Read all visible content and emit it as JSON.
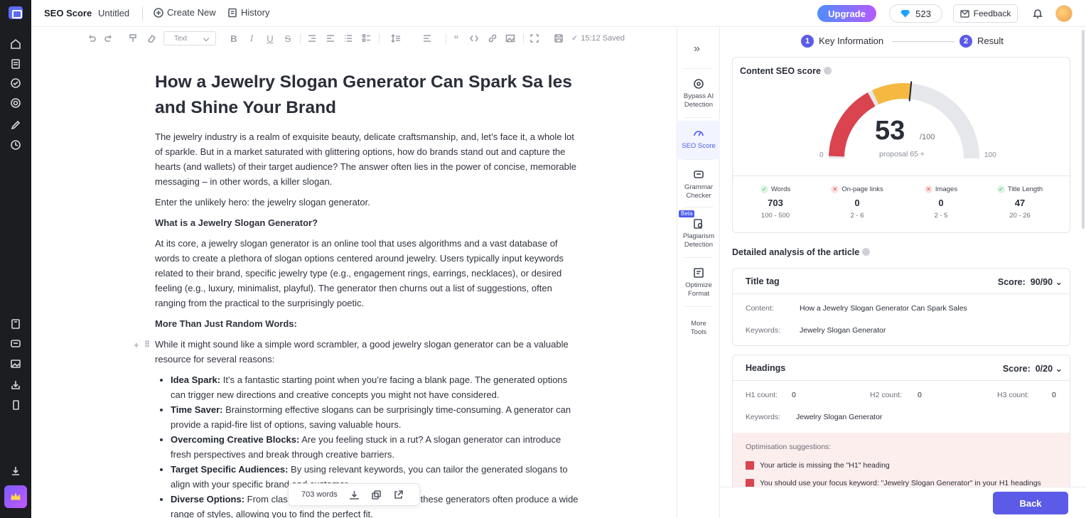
{
  "topbar": {
    "title": "SEO Score",
    "doc_name": "Untitled",
    "create_new": "Create New",
    "history": "History",
    "upgrade": "Upgrade",
    "credits": "523",
    "feedback": "Feedback"
  },
  "toolbar": {
    "text_style": "Text",
    "saved": "15:12 Saved"
  },
  "article": {
    "title": "How a Jewelry Slogan Generator Can Spark Sa les and Shine Your Brand",
    "p1": "The jewelry industry is a realm of exquisite beauty, delicate craftsmanship, and, let’s face it, a whole lot of sparkle. But in a market saturated with glittering options, how do brands stand out and capture the hearts (and wallets) of their target audience? The answer often lies in the power of concise, memorable messaging – in other words, a killer slogan.",
    "p2": "Enter the unlikely hero: the jewelry slogan generator.",
    "h2": "What is a Jewelry Slogan Generator?",
    "p3": "At its core, a jewelry slogan generator is an online tool that uses algorithms and a vast database of words to create a plethora of slogan options centered around jewelry. Users typically input keywords related to their brand, specific jewelry type (e.g., engagement rings, earrings, necklaces), or desired feeling (e.g., luxury, minimalist, playful). The generator then churns out a list of suggestions, often ranging from the practical to the surprisingly poetic.",
    "h3": "More Than Just Random Words:",
    "p4": "While it might sound like a simple word scrambler, a good jewelry slogan generator can be a valuable resource for several reasons:",
    "list": [
      {
        "bold": "Idea Spark:",
        "text": " It’s a fantastic starting point when you’re facing a blank page. The generated options can trigger new directions and creative concepts you might not have considered."
      },
      {
        "bold": "Time Saver:",
        "text": " Brainstorming effective slogans can be surprisingly time-consuming. A generator can provide a rapid-fire list of options, saving valuable hours."
      },
      {
        "bold": "Overcoming Creative Blocks:",
        "text": " Are you feeling stuck in a rut? A slogan generator can introduce fresh perspectives and break through creative barriers."
      },
      {
        "bold": "Target Specific Audiences:",
        "text": " By using relevant keywords, you can tailor the generated slogans to align with your specific brand and customer."
      },
      {
        "bold": "Diverse Options:",
        "text": " From classic and elegant to fun and edgy, these generators often produce a wide range of styles, allowing you to find the perfect fit."
      }
    ],
    "word_count": "703 words"
  },
  "tools": {
    "bypass": "Bypass AI Detection",
    "seo": "SEO Score",
    "grammar": "Grammar Checker",
    "beta": "Beta",
    "plagiarism": "Plagiarism Detection",
    "optimize": "Optimize Format",
    "more": "More Tools"
  },
  "steps": {
    "s1_num": "1",
    "s1": "Key Information",
    "s2_num": "2",
    "s2": "Result"
  },
  "seo": {
    "title": "Content SEO score",
    "score": "53",
    "max": "/100",
    "proposal": "proposal 65 +",
    "min_label": "0",
    "max_label": "100",
    "score_value": 53,
    "metrics": [
      {
        "label": "Words",
        "status": "ok",
        "value": "703",
        "range": "100 - 500"
      },
      {
        "label": "On-page links",
        "status": "bad",
        "value": "0",
        "range": "2 - 6"
      },
      {
        "label": "Images",
        "status": "bad",
        "value": "0",
        "range": "2 - 5"
      },
      {
        "label": "Title Length",
        "status": "ok",
        "value": "47",
        "range": "20 - 26"
      }
    ]
  },
  "detail": {
    "title": "Detailed analysis of the article",
    "title_tag": {
      "label": "Title tag",
      "score_label": "Score:",
      "score": "90/90",
      "content_key": "Content:",
      "content_val": "How a Jewelry Slogan Generator Can Spark Sales",
      "keywords_key": "Keywords:",
      "keywords_val": "Jewelry Slogan Generator"
    },
    "headings": {
      "label": "Headings",
      "score_label": "Score:",
      "score": "0/20",
      "h1_key": "H1 count:",
      "h1_val": "0",
      "h2_key": "H2 count:",
      "h2_val": "0",
      "h3_key": "H3 count:",
      "h3_val": "0",
      "keywords_key": "Keywords:",
      "keywords_val": "Jewelry Slogan Generator",
      "suggest_title": "Optimisation suggestions:",
      "suggestions": [
        "Your article is missing the \"H1\" heading",
        "You should use your focus keyword: \"Jewelry Slogan Generator\" in your H1 headings"
      ]
    }
  },
  "footer": {
    "back": "Back"
  },
  "colors": {
    "accent": "#5b5be8",
    "gauge_red": "#d9444e",
    "gauge_yellow": "#f5b942",
    "gauge_grey": "#e6e7ea"
  }
}
